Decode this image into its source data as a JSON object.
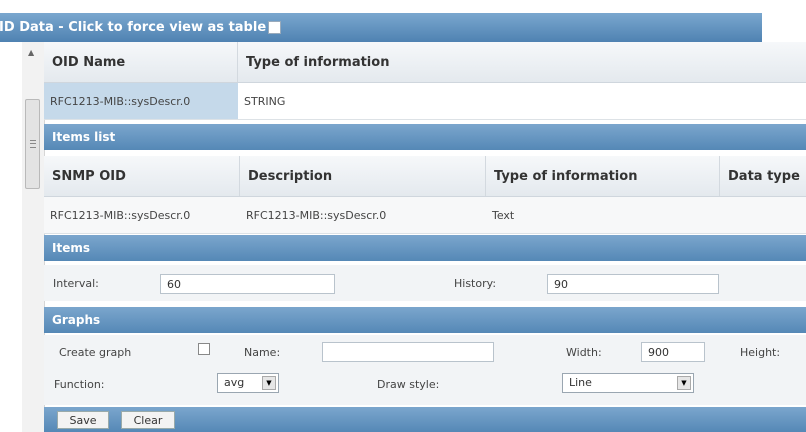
{
  "title": "OID Data - Click to force view as table",
  "oid_table": {
    "headers": [
      "OID Name",
      "Type of information"
    ],
    "row": [
      "RFC1213-MIB::sysDescr.0",
      "STRING"
    ]
  },
  "items_list": {
    "section_label": "Items list",
    "headers": [
      "SNMP OID",
      "Description",
      "Type of information",
      "Data type"
    ],
    "row": [
      "RFC1213-MIB::sysDescr.0",
      "RFC1213-MIB::sysDescr.0",
      "Text",
      ""
    ]
  },
  "items": {
    "section_label": "Items",
    "interval_label": "Interval:",
    "interval_value": "60",
    "history_label": "History:",
    "history_value": "90"
  },
  "graphs": {
    "section_label": "Graphs",
    "create_graph_label": "Create graph",
    "name_label": "Name:",
    "name_value": "",
    "width_label": "Width:",
    "width_value": "900",
    "height_label": "Height:",
    "function_label": "Function:",
    "function_value": "avg",
    "draw_style_label": "Draw style:",
    "draw_style_value": "Line"
  },
  "buttons": {
    "save": "Save",
    "clear": "Clear"
  }
}
